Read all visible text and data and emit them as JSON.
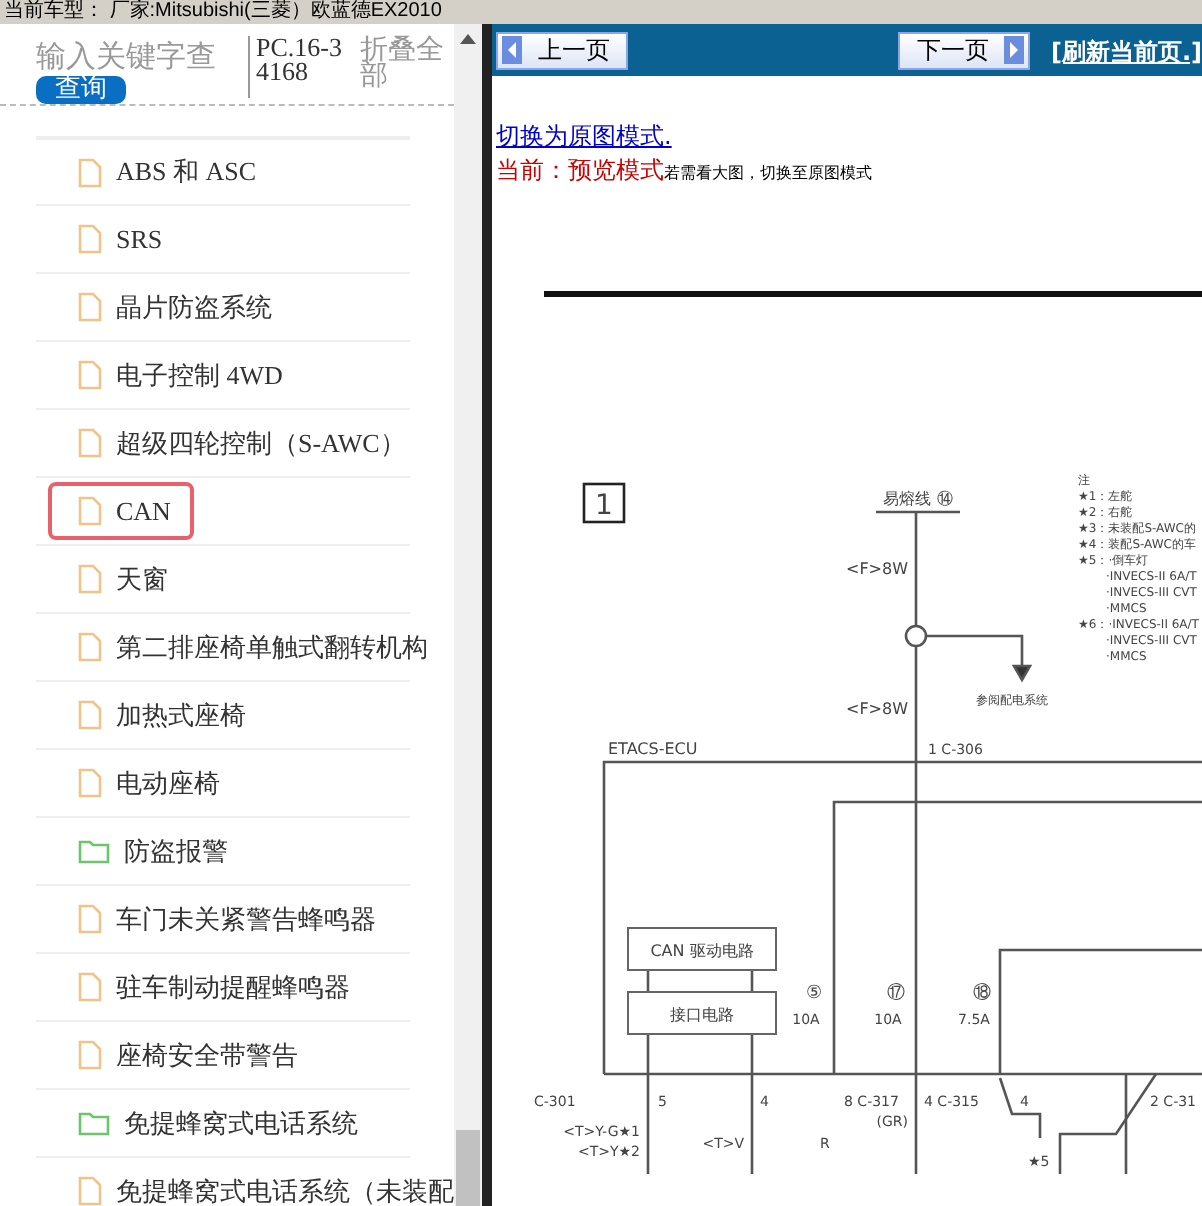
{
  "top_bar": {
    "title": "当前车型： 厂家:Mitsubishi(三菱）欧蓝德EX2010"
  },
  "sidebar": {
    "search": {
      "placeholder": "输入关键字查"
    },
    "search_button": "查询",
    "doc_code": "PC.16-34168",
    "collapse_all": "折叠全部",
    "items": [
      {
        "label": "ABS 和 ASC",
        "kind": "file",
        "selected": false
      },
      {
        "label": "SRS",
        "kind": "file",
        "selected": false
      },
      {
        "label": "晶片防盗系统",
        "kind": "file",
        "selected": false
      },
      {
        "label": "电子控制 4WD",
        "kind": "file",
        "selected": false
      },
      {
        "label": "超级四轮控制（S-AWC）",
        "kind": "file",
        "selected": false
      },
      {
        "label": "CAN",
        "kind": "file",
        "selected": true
      },
      {
        "label": "天窗",
        "kind": "file",
        "selected": false
      },
      {
        "label": "第二排座椅单触式翻转机构",
        "kind": "file",
        "selected": false
      },
      {
        "label": "加热式座椅",
        "kind": "file",
        "selected": false
      },
      {
        "label": "电动座椅",
        "kind": "file",
        "selected": false
      },
      {
        "label": "防盗报警",
        "kind": "folder",
        "selected": false
      },
      {
        "label": "车门未关紧警告蜂鸣器",
        "kind": "file",
        "selected": false
      },
      {
        "label": "驻车制动提醒蜂鸣器",
        "kind": "file",
        "selected": false
      },
      {
        "label": "座椅安全带警告",
        "kind": "file",
        "selected": false
      },
      {
        "label": "免提蜂窝式电话系统",
        "kind": "folder",
        "selected": false
      },
      {
        "label": "免提蜂窝式电话系统（未装配",
        "kind": "file",
        "selected": false
      }
    ]
  },
  "viewer": {
    "prev_button": "上一页",
    "next_button": "下一页",
    "refresh_link": "[刷新当前页.]",
    "switch_link": "切换为原图模式.",
    "mode_label": "当前：预览模式",
    "mode_hint": "若需看大图，切换至原图模式",
    "diagram": {
      "frame_number": "1",
      "fusible_link": "易熔线 ⑭",
      "wire_labels": [
        "<F>8W",
        "<F>8W"
      ],
      "branch_note": "参阅配电系统",
      "ecu": "ETACS-ECU",
      "ecu_pin": "1 C-306",
      "blocks": [
        "CAN 驱动电路",
        "接口电路"
      ],
      "fuses": [
        {
          "number": "⑤",
          "rating": "10A"
        },
        {
          "number": "⑰",
          "rating": "10A"
        },
        {
          "number": "⑱",
          "rating": "7.5A"
        }
      ],
      "pins": [
        "C-301",
        "5",
        "4",
        "8 C-317",
        "4 C-315",
        "4",
        "2 C-31"
      ],
      "wire_colors": [
        "<T>Y-G★1",
        "<T>Y★2",
        "<T>V",
        "R",
        "(GR)",
        "★5"
      ],
      "notes": [
        "注",
        "★1：左舵",
        "★2：右舵",
        "★3：未装配S-AWC的",
        "★4：装配S-AWC的车",
        "★5：·倒车灯",
        "·INVECS-II 6A/T",
        "·INVECS-III CVT",
        "·MMCS",
        "★6：·INVECS-II 6A/T",
        "·INVECS-III CVT",
        "·MMCS"
      ]
    }
  }
}
